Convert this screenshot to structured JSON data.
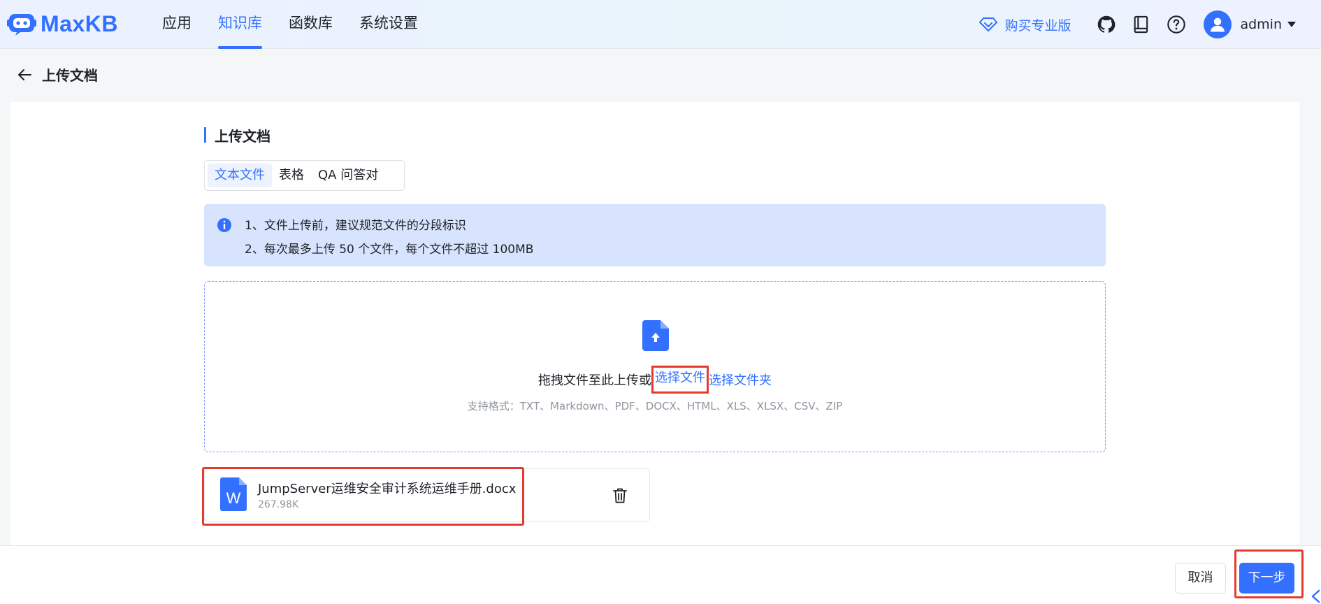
{
  "app": {
    "name": "MaxKB"
  },
  "nav": {
    "items": [
      {
        "label": "应用",
        "active": false
      },
      {
        "label": "知识库",
        "active": true
      },
      {
        "label": "函数库",
        "active": false
      },
      {
        "label": "系统设置",
        "active": false
      }
    ]
  },
  "header": {
    "buy_pro": "购买专业版",
    "user": "admin"
  },
  "page": {
    "back_title": "上传文档"
  },
  "upload": {
    "section_title": "上传文档",
    "tabs": [
      {
        "label": "文本文件",
        "active": true
      },
      {
        "label": "表格",
        "active": false
      },
      {
        "label": "QA 问答对",
        "active": false
      }
    ],
    "notice": {
      "line1": "1、文件上传前，建议规范文件的分段标识",
      "line2": "2、每次最多上传 50 个文件，每个文件不超过 100MB"
    },
    "dropzone": {
      "prompt": "拖拽文件至此上传或",
      "select_file": "选择文件",
      "select_folder": "选择文件夹",
      "formats": "支持格式：TXT、Markdown、PDF、DOCX、HTML、XLS、XLSX、CSV、ZIP"
    },
    "files": [
      {
        "name": "JumpServer运维安全审计系统运维手册.docx",
        "size": "267.98K",
        "icon_letter": "W"
      }
    ]
  },
  "footer": {
    "cancel_label": "取消",
    "next_label": "下一步"
  },
  "colors": {
    "primary": "#3370ff",
    "highlight": "#e53b2f",
    "notice_bg": "#d8e3fd"
  }
}
